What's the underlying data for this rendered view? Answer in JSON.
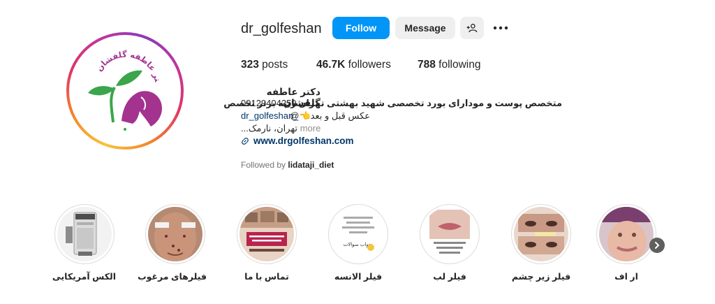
{
  "profile": {
    "username": "dr_golfeshan",
    "avatar_logo_text": "دکتر عاطفه گلفشان",
    "follow_label": "Follow",
    "message_label": "Message",
    "suggest_icon": "add-person-icon",
    "more_icon": "more-horizontal-icon"
  },
  "stats": {
    "posts_count": "323",
    "posts_label": " posts",
    "followers_count": "46.7K",
    "followers_label": " followers",
    "following_count": "788",
    "following_label": " following"
  },
  "bio": {
    "name": "دکتر عاطفه گلفشان",
    "line1": "متخصص پوست و مودارای بورد تخصصی شهید بهشتی تهران رتبه برتر تخصص",
    "phone": "09129404259",
    "line2": "عکس قبل و بعد👈@",
    "mention": "dr_golfeshan_",
    "line3": "...تهران، نارمک",
    "more": "more",
    "website": "www.drgolfeshan.com",
    "followed_by_prefix": "Followed by ",
    "followed_by_user": "lidataji_diet"
  },
  "highlights": [
    {
      "label": "ار اف"
    },
    {
      "label": "فیلر زیر چشم"
    },
    {
      "label": "فیلر لب"
    },
    {
      "label": "فیلر الانسه"
    },
    {
      "label": "تماس با ما"
    },
    {
      "label": "فیلرهای مرغوب"
    },
    {
      "label": "الکس آمریکایی"
    }
  ],
  "highlight_texts": {
    "anese_caption": "جواب سوالات"
  },
  "colors": {
    "accent": "#0095f6",
    "link": "#00376b",
    "secondary_button": "#efefef",
    "muted_text": "#737373",
    "logo_green": "#3aa54a",
    "logo_purple": "#a3338f"
  }
}
